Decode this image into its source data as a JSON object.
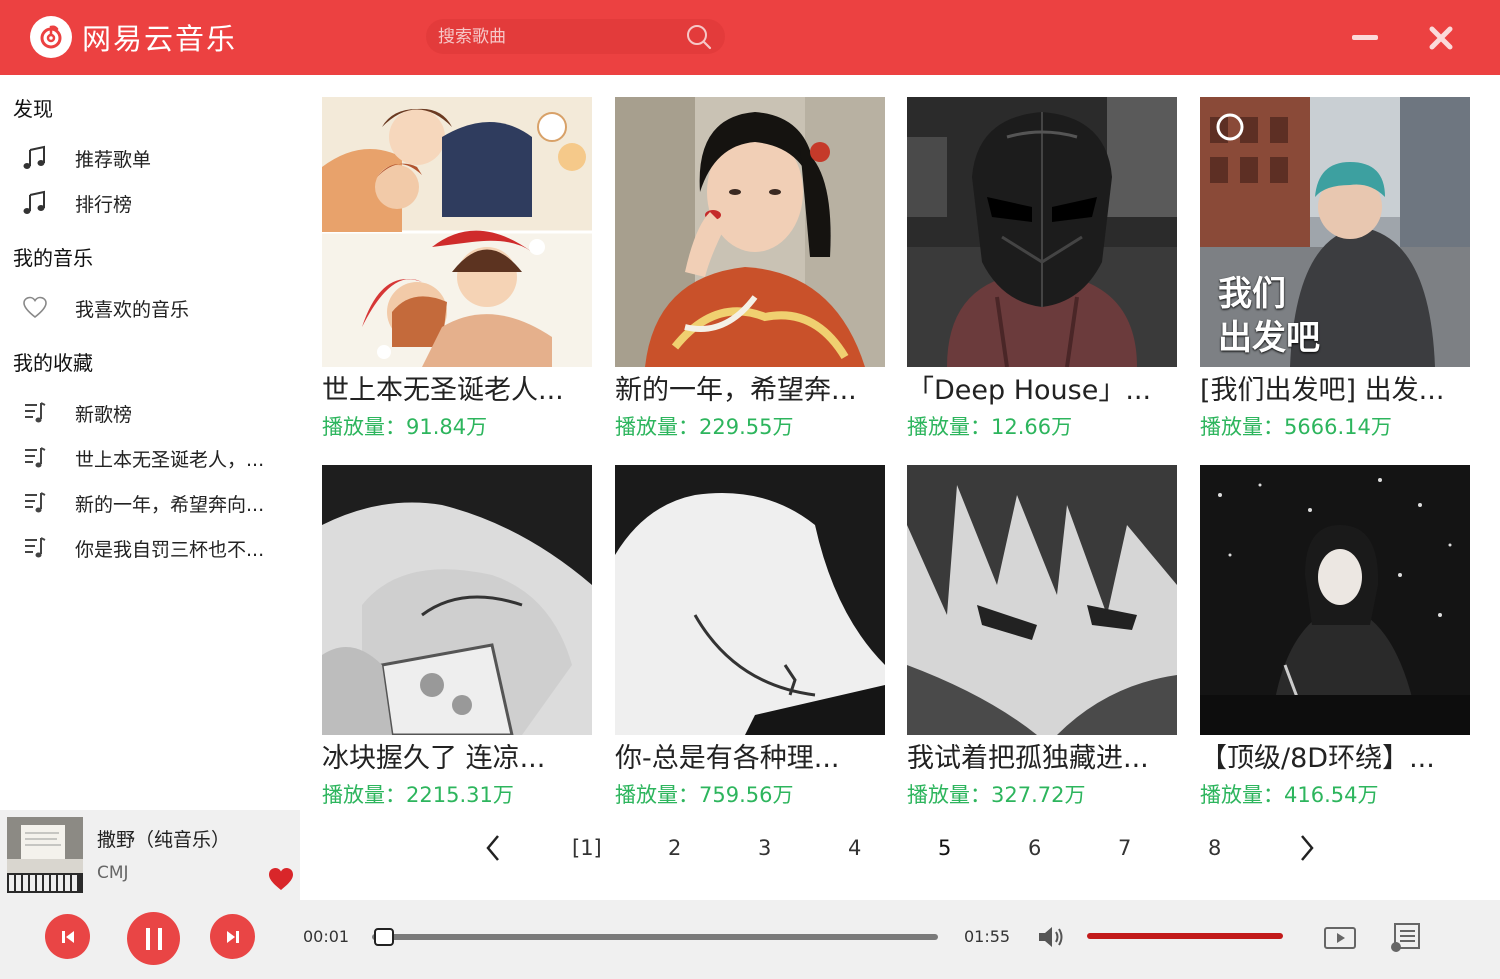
{
  "app": {
    "title": "网易云音乐"
  },
  "search": {
    "placeholder": "搜索歌曲"
  },
  "colors": {
    "brand": "#ec4141",
    "accent_green": "#2db55d",
    "volume": "#c21a1a"
  },
  "sidebar": {
    "sections": [
      {
        "title": "发现"
      },
      {
        "title": "我的音乐"
      },
      {
        "title": "我的收藏"
      }
    ],
    "discover_items": [
      {
        "label": "推荐歌单",
        "icon": "music-note-icon"
      },
      {
        "label": "排行榜",
        "icon": "music-note-icon"
      }
    ],
    "my_music_items": [
      {
        "label": "我喜欢的音乐",
        "icon": "heart-outline-icon"
      }
    ],
    "collection_items": [
      {
        "label": "新歌榜",
        "icon": "playlist-icon"
      },
      {
        "label": "世上本无圣诞老人，...",
        "icon": "playlist-icon"
      },
      {
        "label": "新的一年，希望奔向...",
        "icon": "playlist-icon"
      },
      {
        "label": "你是我自罚三杯也不...",
        "icon": "playlist-icon"
      }
    ]
  },
  "playlists": [
    {
      "title": "世上本无圣诞老人...",
      "plays": "播放量：91.84万"
    },
    {
      "title": "新的一年，希望奔...",
      "plays": "播放量：229.55万"
    },
    {
      "title": "「Deep House」...",
      "plays": "播放量：12.66万"
    },
    {
      "title": "[我们出发吧] 出发...",
      "plays": "播放量：5666.14万",
      "cover_text": [
        "我们",
        "出发吧"
      ]
    },
    {
      "title": "冰块握久了 连凉...",
      "plays": "播放量：2215.31万"
    },
    {
      "title": "你-总是有各种理...",
      "plays": "播放量：759.56万"
    },
    {
      "title": "我试着把孤独藏进...",
      "plays": "播放量：327.72万"
    },
    {
      "title": "【顶级/8D环绕】...",
      "plays": "播放量：416.54万"
    }
  ],
  "pagination": {
    "prev": "<",
    "next": ">",
    "pages": [
      "[1]",
      "2",
      "3",
      "4",
      "5",
      "6",
      "7",
      "8"
    ],
    "current": 1
  },
  "now_playing": {
    "title": "撒野（纯音乐）",
    "artist": "CMJ",
    "liked": true
  },
  "player": {
    "current_time": "00:01",
    "total_time": "01:55",
    "progress": 0.01,
    "volume": 1.0,
    "state": "playing"
  }
}
